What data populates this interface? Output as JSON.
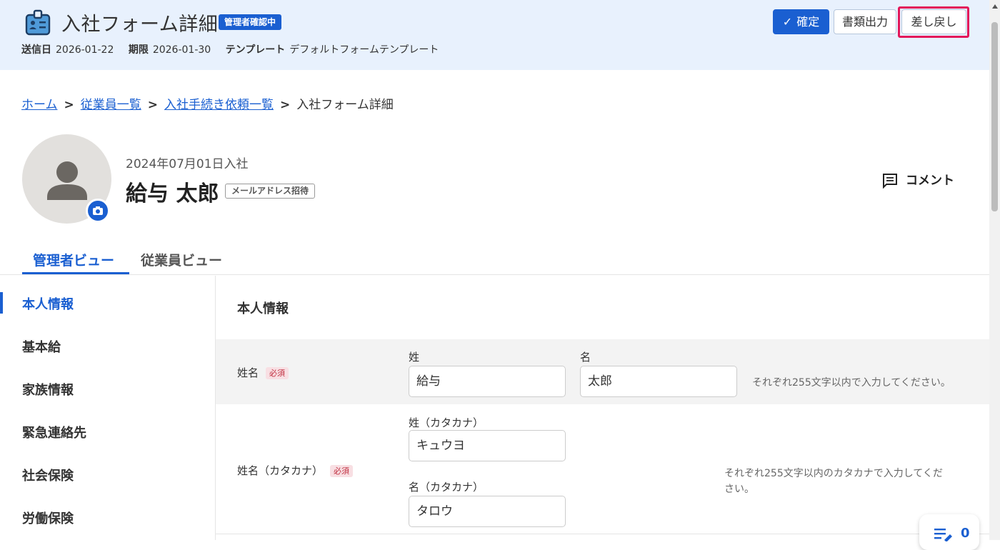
{
  "header": {
    "icon": "id-badge-icon",
    "title": "入社フォーム詳細",
    "status_badge": "管理者確認中",
    "meta": {
      "sent_label": "送信日",
      "sent_value": "2026-01-22",
      "deadline_label": "期限",
      "deadline_value": "2026-01-30",
      "template_label": "テンプレート",
      "template_value": "デフォルトフォームテンプレート"
    },
    "buttons": {
      "confirm": "確定",
      "export": "書類出力",
      "return": "差し戻し"
    },
    "accent_color": "#1a5fd1",
    "highlight_color": "#e3175a"
  },
  "breadcrumb": {
    "items": [
      "ホーム",
      "従業員一覧",
      "入社手続き依頼一覧"
    ],
    "current": "入社フォーム詳細"
  },
  "profile": {
    "join_date": "2024年07月01日入社",
    "name": "給与 太郎",
    "invite_badge": "メールアドレス招待",
    "comment_label": "コメント"
  },
  "tabs": {
    "admin": "管理者ビュー",
    "employee": "従業員ビュー"
  },
  "sidenav": {
    "items": [
      "本人情報",
      "基本給",
      "家族情報",
      "緊急連絡先",
      "社会保険",
      "労働保険"
    ],
    "active": "本人情報"
  },
  "section": {
    "title": "本人情報",
    "required_label": "必須",
    "name_row": {
      "label": "姓名",
      "last_label": "姓",
      "last_value": "給与",
      "first_label": "名",
      "first_value": "太郎",
      "hint": "それぞれ255文字以内で入力してください。"
    },
    "kana_row": {
      "label": "姓名（カタカナ）",
      "last_label": "姓（カタカナ）",
      "last_value": "キュウヨ",
      "first_label": "名（カタカナ）",
      "first_value": "タロウ",
      "hint_line1": "それぞれ255文字以内のカタカナで入力してくだ",
      "hint_line2": "さい。"
    }
  },
  "floating": {
    "icon": "list-edit-icon",
    "count": "0"
  }
}
